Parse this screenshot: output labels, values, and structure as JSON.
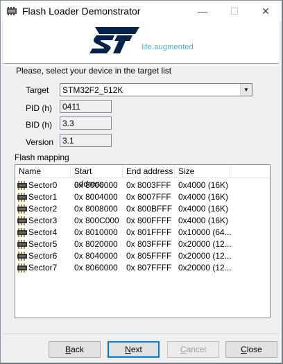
{
  "window": {
    "title": "Flash Loader Demonstrator"
  },
  "banner": {
    "tagline": "life.augmented"
  },
  "prompt": "Please, select your device in the target list",
  "target": {
    "label": "Target",
    "value": "STM32F2_512K"
  },
  "pid": {
    "label": "PID  (h)",
    "value": "0411"
  },
  "bid": {
    "label": "BID  (h)",
    "value": "3.3"
  },
  "version": {
    "label": "Version",
    "value": "3.1"
  },
  "flash_mapping": {
    "label": "Flash mapping",
    "columns": [
      "Name",
      "Start address",
      "End address",
      "Size"
    ],
    "rows": [
      {
        "name": "Sector0",
        "start": "0x 8000000",
        "end": "0x 8003FFF",
        "size": "0x4000 (16K)"
      },
      {
        "name": "Sector1",
        "start": "0x 8004000",
        "end": "0x 8007FFF",
        "size": "0x4000 (16K)"
      },
      {
        "name": "Sector2",
        "start": "0x 8008000",
        "end": "0x 800BFFF",
        "size": "0x4000 (16K)"
      },
      {
        "name": "Sector3",
        "start": "0x 800C000",
        "end": "0x 800FFFF",
        "size": "0x4000 (16K)"
      },
      {
        "name": "Sector4",
        "start": "0x 8010000",
        "end": "0x 801FFFF",
        "size": "0x10000 (64..."
      },
      {
        "name": "Sector5",
        "start": "0x 8020000",
        "end": "0x 803FFFF",
        "size": "0x20000 (12..."
      },
      {
        "name": "Sector6",
        "start": "0x 8040000",
        "end": "0x 805FFFF",
        "size": "0x20000 (12..."
      },
      {
        "name": "Sector7",
        "start": "0x 8060000",
        "end": "0x 807FFFF",
        "size": "0x20000 (12..."
      }
    ]
  },
  "buttons": {
    "back": {
      "first": "B",
      "rest": "ack"
    },
    "next": {
      "first": "N",
      "rest": "ext"
    },
    "cancel": {
      "first": "C",
      "rest": "ancel",
      "disabled": true
    },
    "close": {
      "first": "C",
      "rest": "lose"
    }
  },
  "colors": {
    "accent": "#0078d7",
    "brand_blue": "#03234b",
    "tagline": "#3cb4e5"
  },
  "icons": {
    "app": "flash-loader-icon",
    "sector": "chip-icon",
    "dropdown": "chevron-down-icon"
  }
}
